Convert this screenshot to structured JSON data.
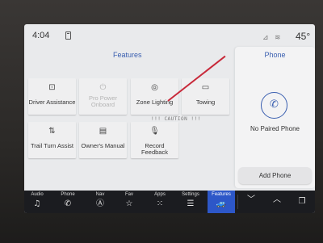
{
  "status": {
    "time": "4:04",
    "temperature": "45°",
    "icons": [
      "phone-status-icon",
      "signal-icon",
      "wifi-icon"
    ]
  },
  "features": {
    "title": "Features",
    "tiles": [
      {
        "label": "Driver Assistance",
        "icon": "driver-assistance-icon",
        "glyph": "⊡",
        "enabled": true
      },
      {
        "label": "Pro Power Onboard",
        "icon": "power-outlet-icon",
        "glyph": "⏻",
        "enabled": false
      },
      {
        "label": "Zone Lighting",
        "icon": "zone-lighting-icon",
        "glyph": "◎",
        "enabled": true
      },
      {
        "label": "Towing",
        "icon": "towing-icon",
        "glyph": "▭",
        "enabled": true
      },
      {
        "label": "Trail Turn Assist",
        "icon": "trail-turn-icon",
        "glyph": "⇅",
        "enabled": true
      },
      {
        "label": "Owner's Manual",
        "icon": "manual-icon",
        "glyph": "▤",
        "enabled": true
      },
      {
        "label": "Record Feedback",
        "icon": "microphone-icon",
        "glyph": "🎙",
        "enabled": true
      }
    ],
    "caution_overlay": "!!! CAUTION !!!"
  },
  "phone": {
    "title": "Phone",
    "status": "No Paired Phone",
    "add_button": "Add Phone",
    "icon": "phone-handset-icon"
  },
  "nav": {
    "items": [
      {
        "label": "Audio",
        "icon": "music-note-icon",
        "glyph": "♫",
        "active": false
      },
      {
        "label": "Phone",
        "icon": "phone-icon",
        "glyph": "✆",
        "active": false
      },
      {
        "label": "Nav",
        "icon": "navigation-icon",
        "glyph": "Ⓐ",
        "active": false
      },
      {
        "label": "Fav",
        "icon": "star-icon",
        "glyph": "☆",
        "active": false
      },
      {
        "label": "Apps",
        "icon": "apps-grid-icon",
        "glyph": "⁙",
        "active": false
      },
      {
        "label": "Settings",
        "icon": "settings-sliders-icon",
        "glyph": "☰",
        "active": false
      },
      {
        "label": "Features",
        "icon": "car-icon",
        "glyph": "🚙",
        "active": true
      }
    ],
    "extra": [
      {
        "icon": "chevron-down-icon",
        "glyph": "﹀"
      },
      {
        "icon": "chevron-up-icon",
        "glyph": "︿"
      },
      {
        "icon": "copy-pages-icon",
        "glyph": "❐"
      }
    ]
  },
  "colors": {
    "accent": "#3a5fb0",
    "nav_active": "#2d57c8",
    "nav_bg": "#1b1c20",
    "screen_bg": "#e9eaec",
    "annotation_line": "#c8293a"
  }
}
